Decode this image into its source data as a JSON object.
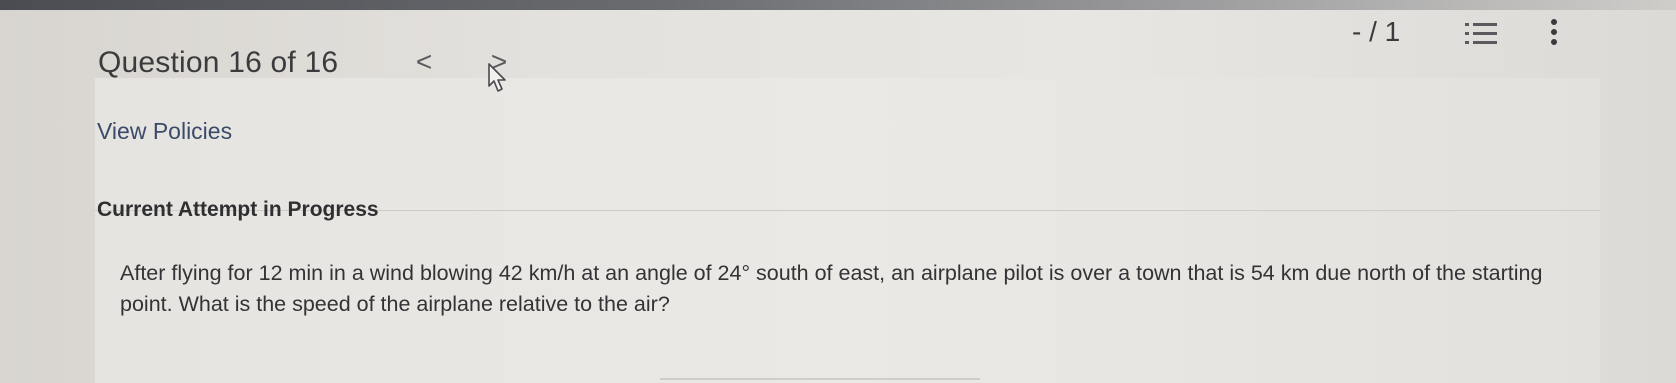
{
  "header": {
    "question_label": "Question 16 of 16",
    "prev_label": "<",
    "next_label": ">",
    "score": "- / 1"
  },
  "icons": {
    "prev": "chevron-left-icon",
    "next": "chevron-right-icon",
    "question_list": "list-icon",
    "more": "more-vertical-icon",
    "pointer": "mouse-cursor-icon"
  },
  "links": {
    "view_policies": "View Policies"
  },
  "attempt": {
    "title": "Current Attempt in Progress"
  },
  "question": {
    "text": "After flying for 12 min in a wind blowing 42 km/h at an angle of 24° south of east, an airplane pilot is over a town that is 54 km due north of the starting point. What is the speed of the airplane relative to the air?"
  }
}
